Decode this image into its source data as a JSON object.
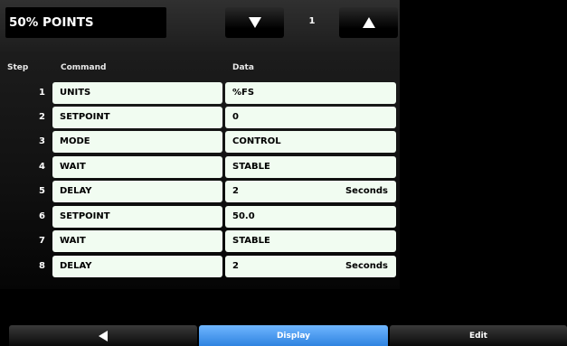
{
  "title": "50% POINTS",
  "page_number": "1",
  "headers": {
    "step": "Step",
    "command": "Command",
    "data": "Data"
  },
  "rows": [
    {
      "step": "1",
      "command": "UNITS",
      "data": "%FS",
      "unit": ""
    },
    {
      "step": "2",
      "command": "SETPOINT",
      "data": "0",
      "unit": ""
    },
    {
      "step": "3",
      "command": "MODE",
      "data": "CONTROL",
      "unit": ""
    },
    {
      "step": "4",
      "command": "WAIT",
      "data": "STABLE",
      "unit": ""
    },
    {
      "step": "5",
      "command": "DELAY",
      "data": "2",
      "unit": "Seconds"
    },
    {
      "step": "6",
      "command": "SETPOINT",
      "data": "50.0",
      "unit": ""
    },
    {
      "step": "7",
      "command": "WAIT",
      "data": "STABLE",
      "unit": ""
    },
    {
      "step": "8",
      "command": "DELAY",
      "data": "2",
      "unit": "Seconds"
    }
  ],
  "bottom_tabs": {
    "display": "Display",
    "edit": "Edit"
  },
  "icons": {
    "down": "triangle-down-icon",
    "up": "triangle-up-icon",
    "back": "triangle-left-icon"
  },
  "colors": {
    "cell_background": "#f1fcf1",
    "active_tab": "#4a9cf0"
  }
}
